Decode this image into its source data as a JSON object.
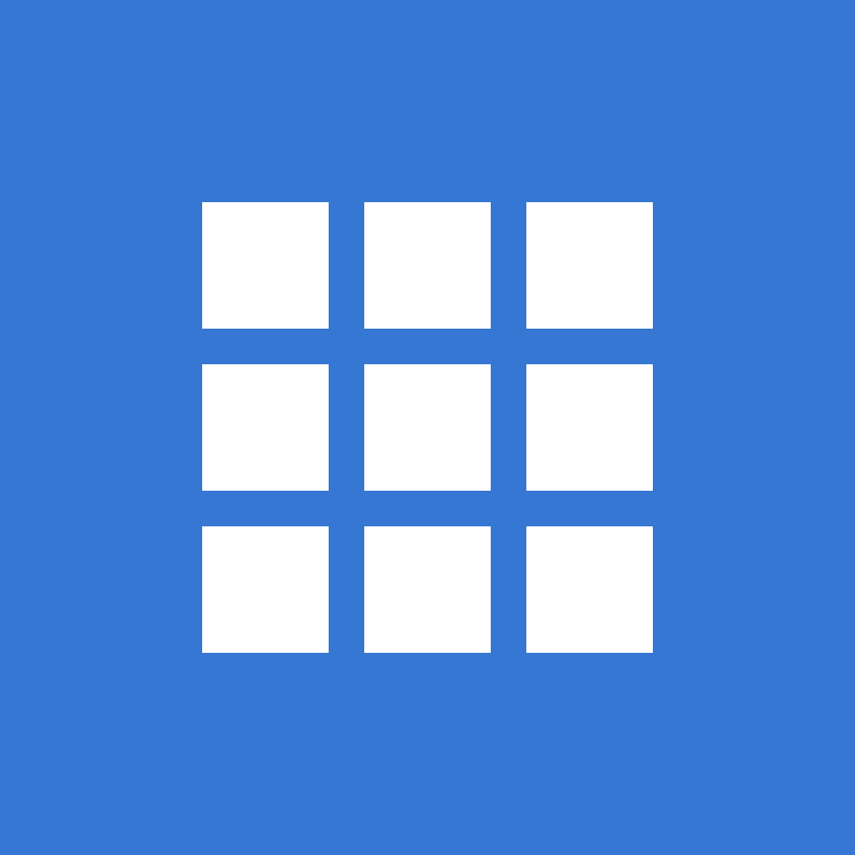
{
  "icon": {
    "name": "grid-icon",
    "background_color": "#3577D2",
    "tile_color": "#FFFFFF",
    "rows": 3,
    "columns": 3
  }
}
